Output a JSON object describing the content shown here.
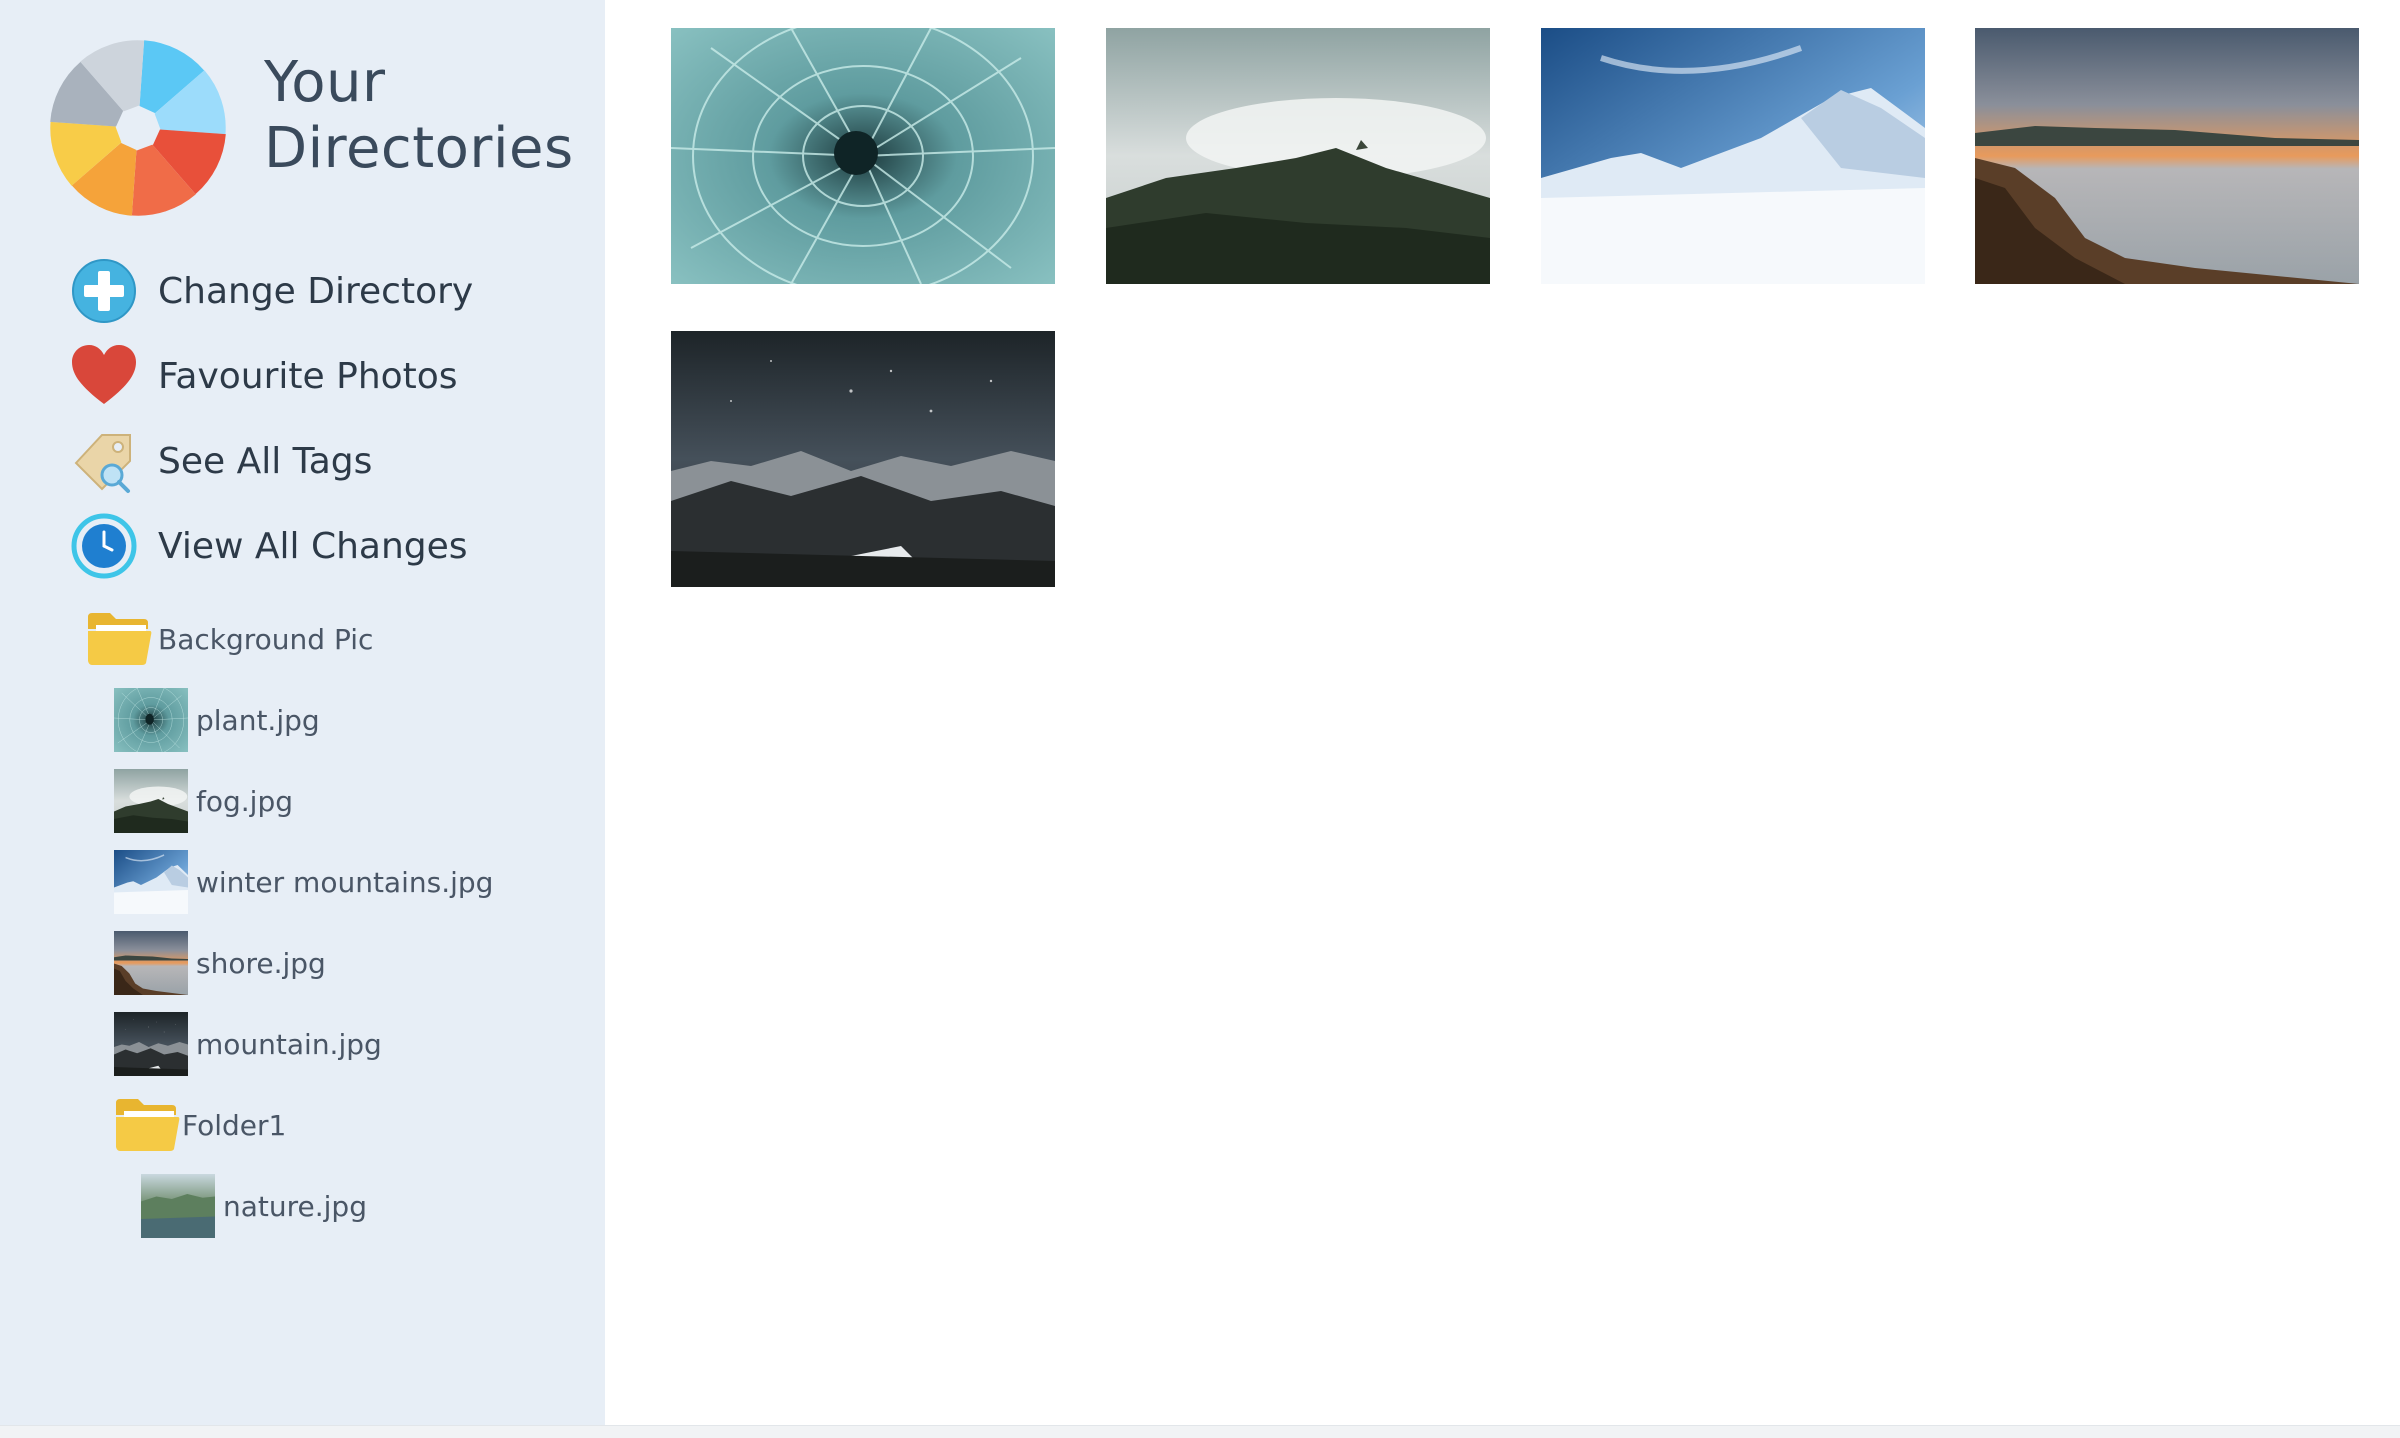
{
  "app": {
    "title": "Your Directories",
    "logo_icon": "pinwheel-logo-icon",
    "logo_colors": [
      "#5bc8f5",
      "#9cdcfb",
      "#e8503a",
      "#f5a33a",
      "#f8cc48",
      "#a9b2bd",
      "#cdd4dc"
    ]
  },
  "nav": {
    "items": [
      {
        "label": "Change Directory",
        "icon": "add-circle-icon",
        "color": "#45b3e0"
      },
      {
        "label": "Favourite Photos",
        "icon": "heart-icon",
        "color": "#d9473a"
      },
      {
        "label": "See All Tags",
        "icon": "tag-search-icon",
        "color": "#e9cf9a"
      },
      {
        "label": "View All Changes",
        "icon": "clock-icon",
        "color": "#2aa7e6"
      }
    ]
  },
  "tree": {
    "root_folder": {
      "label": "Background Pic",
      "icon": "folder-icon"
    },
    "files": [
      {
        "label": "plant.jpg"
      },
      {
        "label": "fog.jpg"
      },
      {
        "label": "winter mountains.jpg"
      },
      {
        "label": "shore.jpg"
      },
      {
        "label": "mountain.jpg"
      }
    ],
    "subfolder": {
      "label": "Folder1",
      "icon": "folder-icon"
    },
    "subfolder_files": [
      {
        "label": "nature.jpg"
      }
    ]
  },
  "gallery": {
    "photos": [
      {
        "name": "plant-photo"
      },
      {
        "name": "fog-photo"
      },
      {
        "name": "winter-mountains-photo"
      },
      {
        "name": "shore-photo"
      },
      {
        "name": "mountain-photo"
      }
    ]
  },
  "colors": {
    "sidebar_bg": "#e7eef6",
    "folder": "#f5ca45",
    "text_dark": "#2d3a48"
  }
}
